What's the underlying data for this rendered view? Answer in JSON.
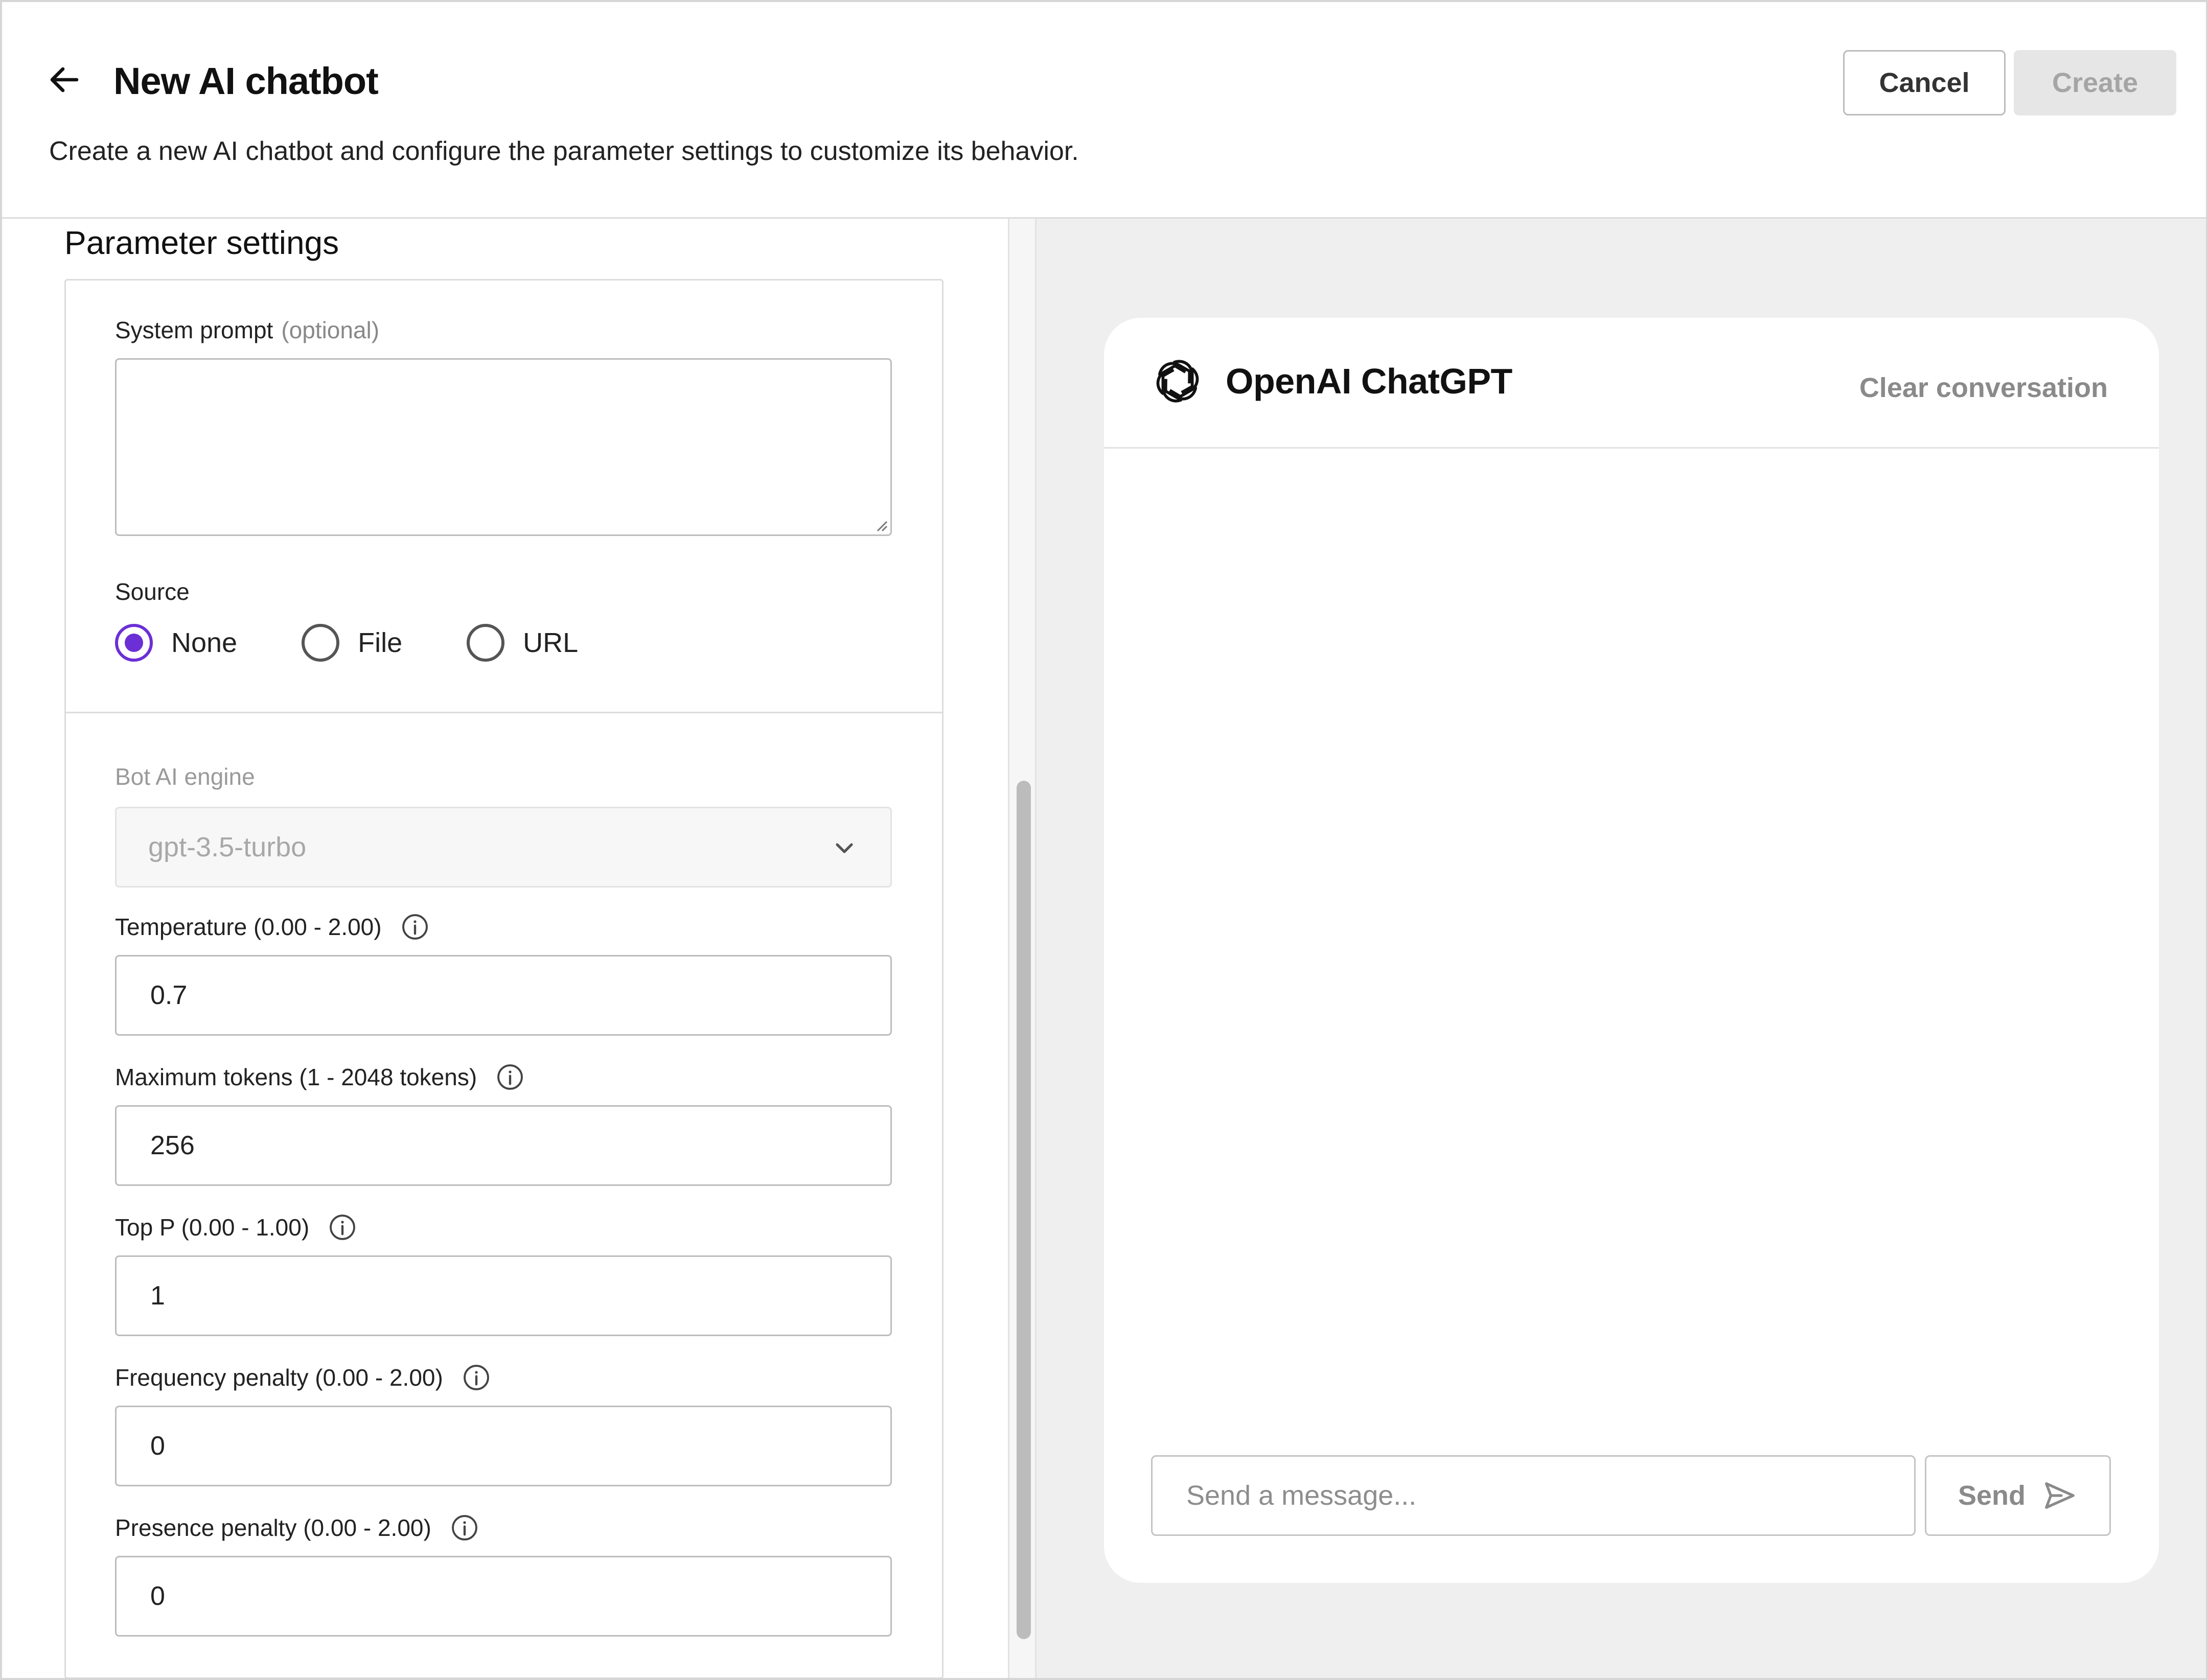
{
  "header": {
    "title": "New AI chatbot",
    "subtitle": "Create a new AI chatbot and configure the parameter settings to customize its behavior.",
    "cancel_label": "Cancel",
    "create_label": "Create"
  },
  "settings": {
    "section_title": "Parameter settings",
    "system_prompt": {
      "label": "System prompt",
      "optional": "(optional)",
      "value": ""
    },
    "source": {
      "label": "Source",
      "options": [
        "None",
        "File",
        "URL"
      ],
      "selected": "None"
    },
    "engine": {
      "label": "Bot AI engine",
      "value": "gpt-3.5-turbo"
    },
    "temperature": {
      "label": "Temperature (0.00 - 2.00)",
      "value": "0.7"
    },
    "max_tokens": {
      "label": "Maximum tokens (1 - 2048 tokens)",
      "value": "256"
    },
    "top_p": {
      "label": "Top P (0.00 - 1.00)",
      "value": "1"
    },
    "frequency_penalty": {
      "label": "Frequency penalty (0.00 - 2.00)",
      "value": "0"
    },
    "presence_penalty": {
      "label": "Presence penalty (0.00 - 2.00)",
      "value": "0"
    }
  },
  "chat": {
    "title": "OpenAI ChatGPT",
    "clear_label": "Clear conversation",
    "input_placeholder": "Send a message...",
    "send_label": "Send"
  },
  "icons": {
    "back": "arrow-left-icon",
    "info": "info-icon",
    "dropdown": "chevron-down-icon",
    "logo": "openai-logo-icon",
    "send": "send-icon"
  },
  "colors": {
    "accent": "#6b2fd6",
    "panel_bg": "#efefef",
    "disabled_text": "#a5a5a5"
  }
}
